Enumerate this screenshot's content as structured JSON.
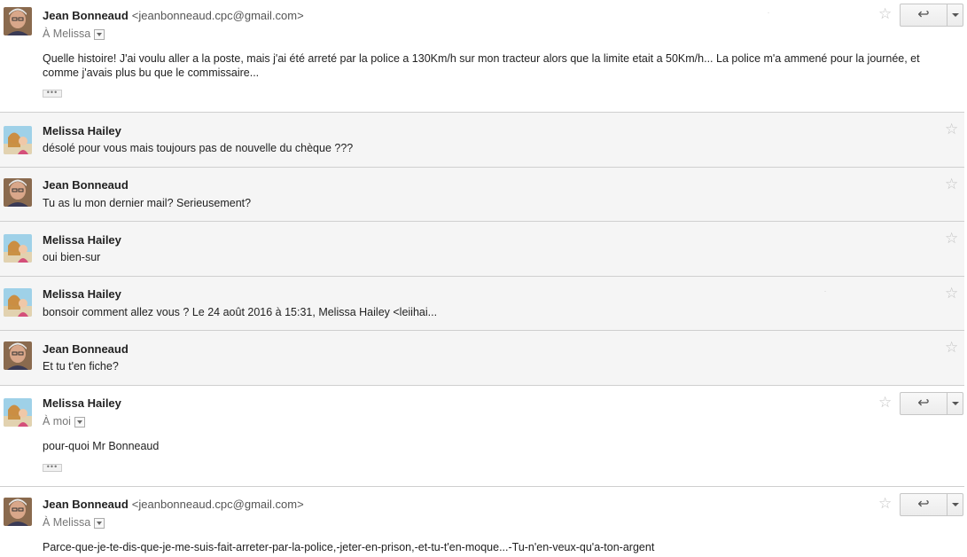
{
  "messages": [
    {
      "sender": "Jean Bonneaud",
      "email": "<jeanbonneaud.cpc@gmail.com>",
      "recipient": "À Melissa",
      "body": "Quelle histoire! J'ai voulu aller a la poste, mais j'ai été arreté par la police a 130Km/h sur mon tracteur alors que la limite etait a 50Km/h... La police m'a ammené pour la journée, et comme j'avais plus bu que le commissaire...",
      "expanded": true
    },
    {
      "sender": "Melissa Hailey",
      "snippet": "désolé pour vous mais toujours pas de nouvelle du chèque ???"
    },
    {
      "sender": "Jean Bonneaud",
      "snippet": "Tu as lu mon dernier mail? Serieusement?"
    },
    {
      "sender": "Melissa Hailey",
      "snippet": "oui bien-sur"
    },
    {
      "sender": "Melissa Hailey",
      "snippet": "bonsoir comment allez vous ? Le 24 août 2016 à 15:31, Melissa Hailey <leiihai..."
    },
    {
      "sender": "Jean Bonneaud",
      "snippet": "Et tu t'en fiche?"
    },
    {
      "sender": "Melissa Hailey",
      "recipient": "À moi",
      "body": "pour-quoi Mr Bonneaud",
      "expanded": true
    },
    {
      "sender": "Jean Bonneaud",
      "email": "<jeanbonneaud.cpc@gmail.com>",
      "recipient": "À Melissa",
      "body": "Parce-que-je-te-dis-que-je-me-suis-fait-arreter-par-la-police,-jeter-en-prison,-et-tu-t'en-moque...-Tu-n'en-veux-qu'a-ton-argent",
      "expanded": true
    }
  ],
  "ui": {
    "dots_label": "•••",
    "reply_icon": "reply-arrow-icon",
    "star_icon": "star-icon"
  }
}
